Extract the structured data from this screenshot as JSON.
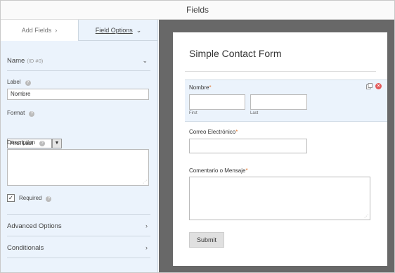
{
  "topbar": {
    "title": "Fields"
  },
  "tabs": {
    "add_fields": "Add Fields",
    "add_fields_chevron": "›",
    "field_options": "Field Options",
    "field_options_chevron": "⌄"
  },
  "options": {
    "header": {
      "name": "Name",
      "id": "(ID #0)",
      "arrow": "⌄"
    },
    "label": {
      "text": "Label",
      "value": "Nombre",
      "help": "?"
    },
    "format": {
      "text": "Format",
      "selected": "First Last",
      "help": "?"
    },
    "description": {
      "text": "Description",
      "value": "",
      "help": "?"
    },
    "required": {
      "text": "Required",
      "checked": true,
      "check_glyph": "✓",
      "help": "?"
    },
    "advanced": {
      "text": "Advanced Options",
      "arrow": "›"
    },
    "conditionals": {
      "text": "Conditionals",
      "arrow": "›"
    }
  },
  "form": {
    "title": "Simple Contact Form",
    "name_field": {
      "label": "Nombre",
      "required_mark": "*",
      "first_sub": "First",
      "last_sub": "Last",
      "delete_glyph": "×"
    },
    "email_field": {
      "label": "Correo Electrónico",
      "required_mark": "*"
    },
    "message_field": {
      "label": "Comentario o Mensaje",
      "required_mark": "*"
    },
    "submit": "Submit"
  },
  "colors": {
    "left_panel_bg": "#ebf3fc",
    "preview_bg": "#686868",
    "required_star": "#e27730",
    "delete_icon": "#e35b5b"
  },
  "icons": [
    "chevron-right-icon",
    "chevron-down-icon",
    "help-icon",
    "checkmark-icon",
    "duplicate-icon",
    "delete-icon",
    "resize-grip-icon"
  ]
}
